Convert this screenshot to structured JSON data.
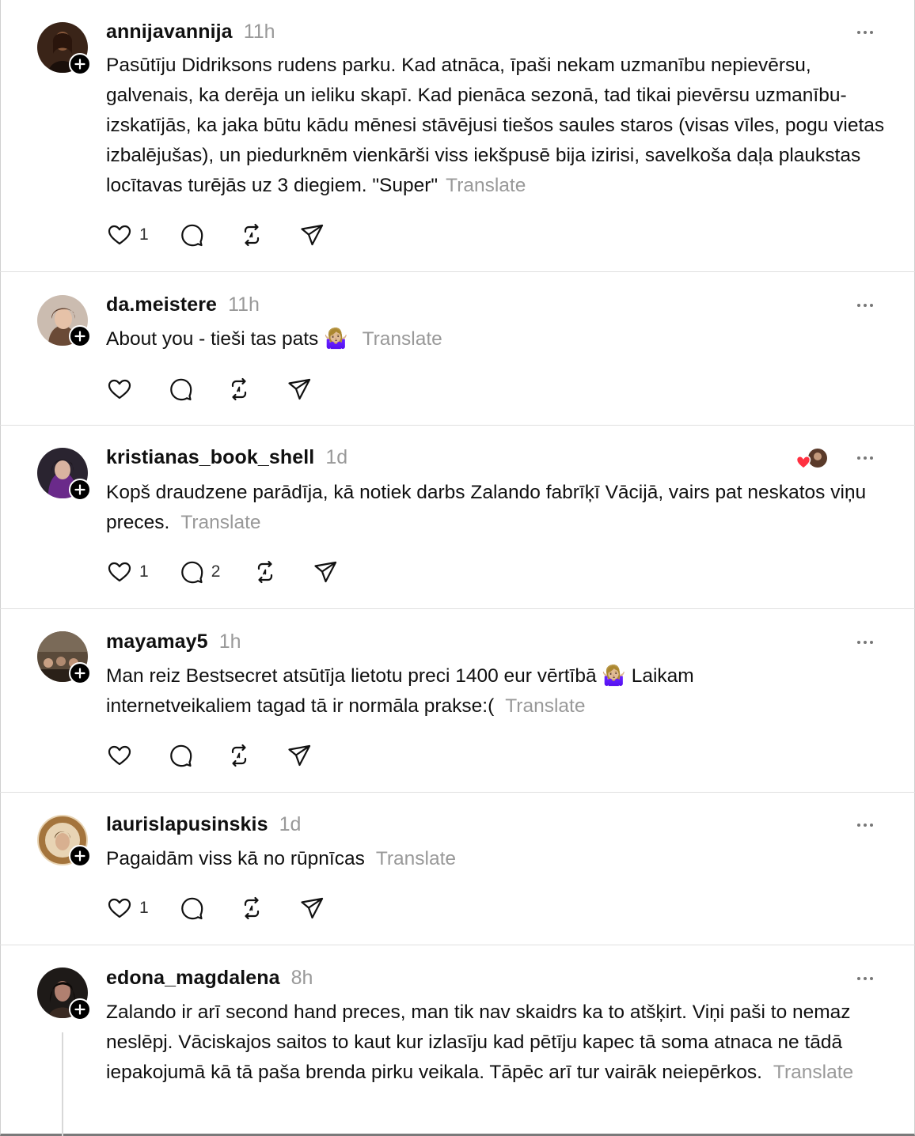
{
  "translate_label": "Translate",
  "posts": [
    {
      "username": "annijavannija",
      "time": "11h",
      "text": "Pasūtīju Didriksons rudens parku. Kad atnāca, īpaši nekam uzmanību nepievērsu, galvenais, ka derēja un ieliku skapī. Kad pienāca sezonā, tad tikai pievērsu uzmanību- izskatījās, ka jaka būtu kādu mēnesi stāvējusi tiešos saules staros (visas vīles, pogu vietas izbalējušas), un piedurknēm vienkārši viss iekšpusē bija izirisi, savelkoša daļa plaukstas locītavas turējās uz 3 diegiem. \"Super\"",
      "likes": "1",
      "replies": ""
    },
    {
      "username": "da.meistere",
      "time": "11h",
      "text": "About you - tieši tas pats 🤷🏼‍♀️",
      "likes": "",
      "replies": ""
    },
    {
      "username": "kristianas_book_shell",
      "time": "1d",
      "text": "Kopš draudzene parādīja, kā notiek darbs Zalando fabrīķī Vācijā, vairs pat neskatos viņu preces.",
      "likes": "1",
      "replies": "2"
    },
    {
      "username": "mayamay5",
      "time": "1h",
      "text": "Man reiz Bestsecret atsūtīja lietotu preci 1400 eur vērtībā 🤷🏼‍♀️ Laikam internetveikaliem tagad tā ir normāla prakse:(",
      "likes": "",
      "replies": ""
    },
    {
      "username": "laurislapusinskis",
      "time": "1d",
      "text": "Pagaidām viss kā no rūpnīcas",
      "likes": "1",
      "replies": ""
    },
    {
      "username": "edona_magdalena",
      "time": "8h",
      "text": "Zalando ir arī second hand preces, man tik nav skaidrs ka to atšķirt. Viņi paši to nemaz neslēpj. Vāciskajos saitos to kaut kur izlasīju kad pētīju kapec tā soma atnaca ne tādā iepakojumā kā tā paša brenda pirku veikala. Tāpēc arī tur vairāk neiepērkos.",
      "likes": "",
      "replies": ""
    }
  ],
  "colors": {
    "text": "#101010",
    "muted": "#999999",
    "divider": "#e0e0e0",
    "reaction_heart": "#ff3040"
  },
  "icons": [
    "plus-icon",
    "more-icon",
    "heart-icon",
    "comment-icon",
    "repost-icon",
    "share-icon"
  ]
}
